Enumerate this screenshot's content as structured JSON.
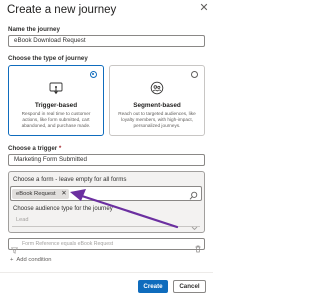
{
  "dialog": {
    "title": "Create a new journey",
    "close_icon": "close-icon"
  },
  "name_field": {
    "label": "Name the journey",
    "value": "eBook Download Request"
  },
  "journey_type": {
    "label": "Choose the type of journey",
    "options": [
      {
        "title": "Trigger-based",
        "description": "Respond in real time to customer actions, like form submitted, cart abandoned, and purchase made.",
        "icon": "touch-icon",
        "selected": true
      },
      {
        "title": "Segment-based",
        "description": "Reach out to targeted audiences, like loyalty members, with high-impact, personalized journeys.",
        "icon": "people-icon",
        "selected": false
      }
    ]
  },
  "trigger": {
    "label": "Choose a trigger",
    "required_mark": "*",
    "value": "Marketing Form Submitted"
  },
  "form_picker": {
    "label": "Choose a form - leave empty for all forms",
    "chip_value": "eBook Request",
    "chip_remove_icon": "dismiss-icon",
    "search_icon": "search-icon"
  },
  "audience": {
    "label": "Choose audience type for the journey",
    "value": "Lead"
  },
  "filter": {
    "text": "Form Reference equals eBook Request",
    "icon": "filter-icon"
  },
  "add_condition": {
    "label": "Add condition"
  },
  "footer": {
    "create_label": "Create",
    "cancel_label": "Cancel"
  },
  "colors": {
    "accent": "#0f6cbd",
    "annotation_arrow": "#6b2fa0"
  }
}
